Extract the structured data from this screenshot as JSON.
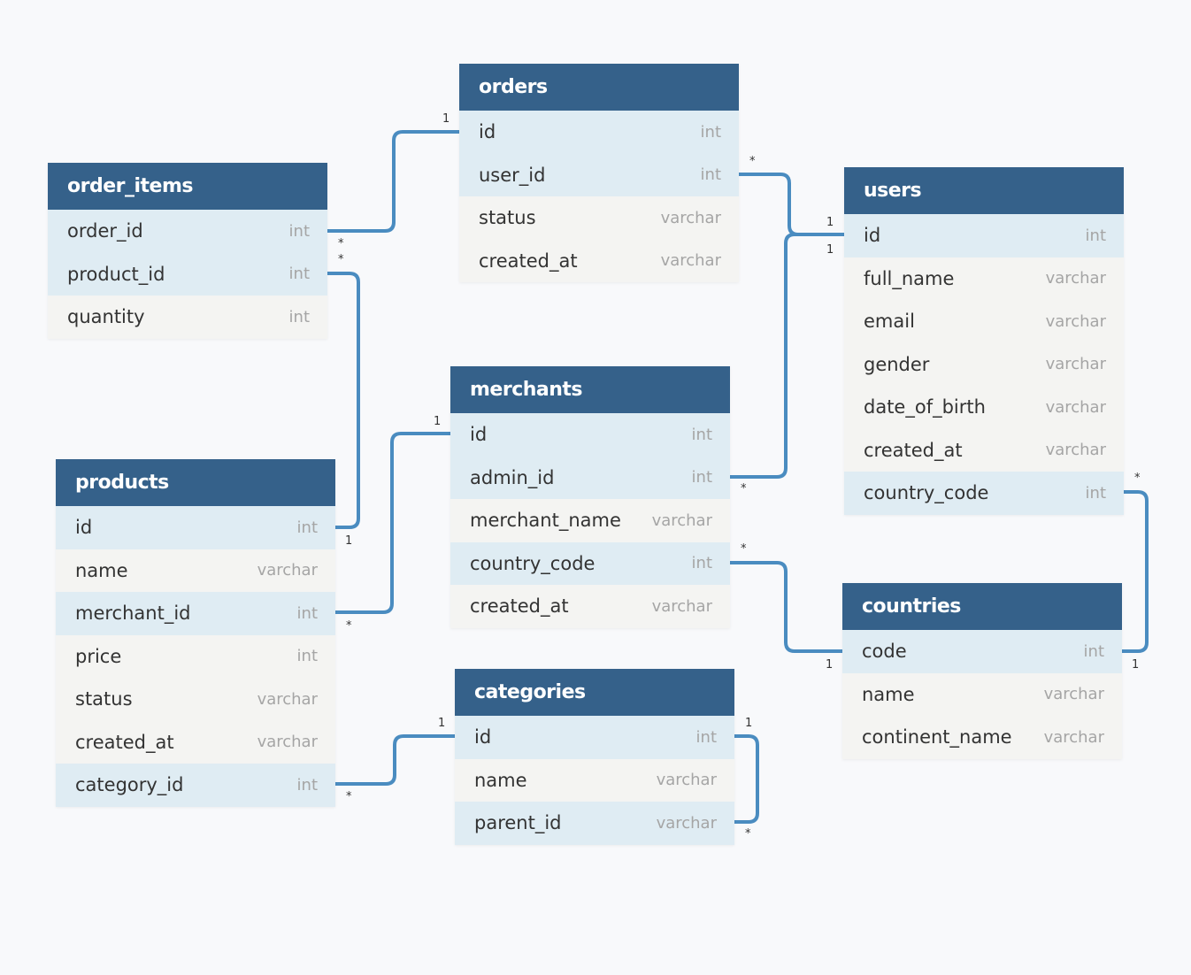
{
  "colors": {
    "header": "#35618a",
    "highlight_row": "#dfecf3",
    "row": "#f4f4f2",
    "link": "#4a8cc0",
    "background": "#f8f9fb"
  },
  "tables": [
    {
      "name": "orders",
      "rows": [
        {
          "name": "id",
          "type": "int",
          "hl": true
        },
        {
          "name": "user_id",
          "type": "int",
          "hl": true
        },
        {
          "name": "status",
          "type": "varchar",
          "hl": false
        },
        {
          "name": "created_at",
          "type": "varchar",
          "hl": false
        }
      ]
    },
    {
      "name": "order_items",
      "rows": [
        {
          "name": "order_id",
          "type": "int",
          "hl": true
        },
        {
          "name": "product_id",
          "type": "int",
          "hl": true
        },
        {
          "name": "quantity",
          "type": "int",
          "hl": false
        }
      ]
    },
    {
      "name": "users",
      "rows": [
        {
          "name": "id",
          "type": "int",
          "hl": true
        },
        {
          "name": "full_name",
          "type": "varchar",
          "hl": false
        },
        {
          "name": "email",
          "type": "varchar",
          "hl": false
        },
        {
          "name": "gender",
          "type": "varchar",
          "hl": false
        },
        {
          "name": "date_of_birth",
          "type": "varchar",
          "hl": false
        },
        {
          "name": "created_at",
          "type": "varchar",
          "hl": false
        },
        {
          "name": "country_code",
          "type": "int",
          "hl": true
        }
      ]
    },
    {
      "name": "merchants",
      "rows": [
        {
          "name": "id",
          "type": "int",
          "hl": true
        },
        {
          "name": "admin_id",
          "type": "int",
          "hl": true
        },
        {
          "name": "merchant_name",
          "type": "varchar",
          "hl": false
        },
        {
          "name": "country_code",
          "type": "int",
          "hl": true
        },
        {
          "name": "created_at",
          "type": "varchar",
          "hl": false
        }
      ]
    },
    {
      "name": "products",
      "rows": [
        {
          "name": "id",
          "type": "int",
          "hl": true
        },
        {
          "name": "name",
          "type": "varchar",
          "hl": false
        },
        {
          "name": "merchant_id",
          "type": "int",
          "hl": true
        },
        {
          "name": "price",
          "type": "int",
          "hl": false
        },
        {
          "name": "status",
          "type": "varchar",
          "hl": false
        },
        {
          "name": "created_at",
          "type": "varchar",
          "hl": false
        },
        {
          "name": "category_id",
          "type": "int",
          "hl": true
        }
      ]
    },
    {
      "name": "countries",
      "rows": [
        {
          "name": "code",
          "type": "int",
          "hl": true
        },
        {
          "name": "name",
          "type": "varchar",
          "hl": false
        },
        {
          "name": "continent_name",
          "type": "varchar",
          "hl": false
        }
      ]
    },
    {
      "name": "categories",
      "rows": [
        {
          "name": "id",
          "type": "int",
          "hl": true
        },
        {
          "name": "name",
          "type": "varchar",
          "hl": false
        },
        {
          "name": "parent_id",
          "type": "varchar",
          "hl": true
        }
      ]
    }
  ],
  "relationships": [
    {
      "from": "order_items.order_id",
      "to": "orders.id",
      "from_card": "*",
      "to_card": "1"
    },
    {
      "from": "order_items.product_id",
      "to": "products.id",
      "from_card": "*",
      "to_card": "1"
    },
    {
      "from": "orders.user_id",
      "to": "users.id",
      "from_card": "*",
      "to_card": "1"
    },
    {
      "from": "merchants.admin_id",
      "to": "users.id",
      "from_card": "*",
      "to_card": "1"
    },
    {
      "from": "products.merchant_id",
      "to": "merchants.id",
      "from_card": "*",
      "to_card": "1"
    },
    {
      "from": "merchants.country_code",
      "to": "countries.code",
      "from_card": "*",
      "to_card": "1"
    },
    {
      "from": "users.country_code",
      "to": "countries.code",
      "from_card": "*",
      "to_card": "1"
    },
    {
      "from": "products.category_id",
      "to": "categories.id",
      "from_card": "*",
      "to_card": "1"
    },
    {
      "from": "categories.parent_id",
      "to": "categories.id",
      "from_card": "*",
      "to_card": "1"
    }
  ]
}
